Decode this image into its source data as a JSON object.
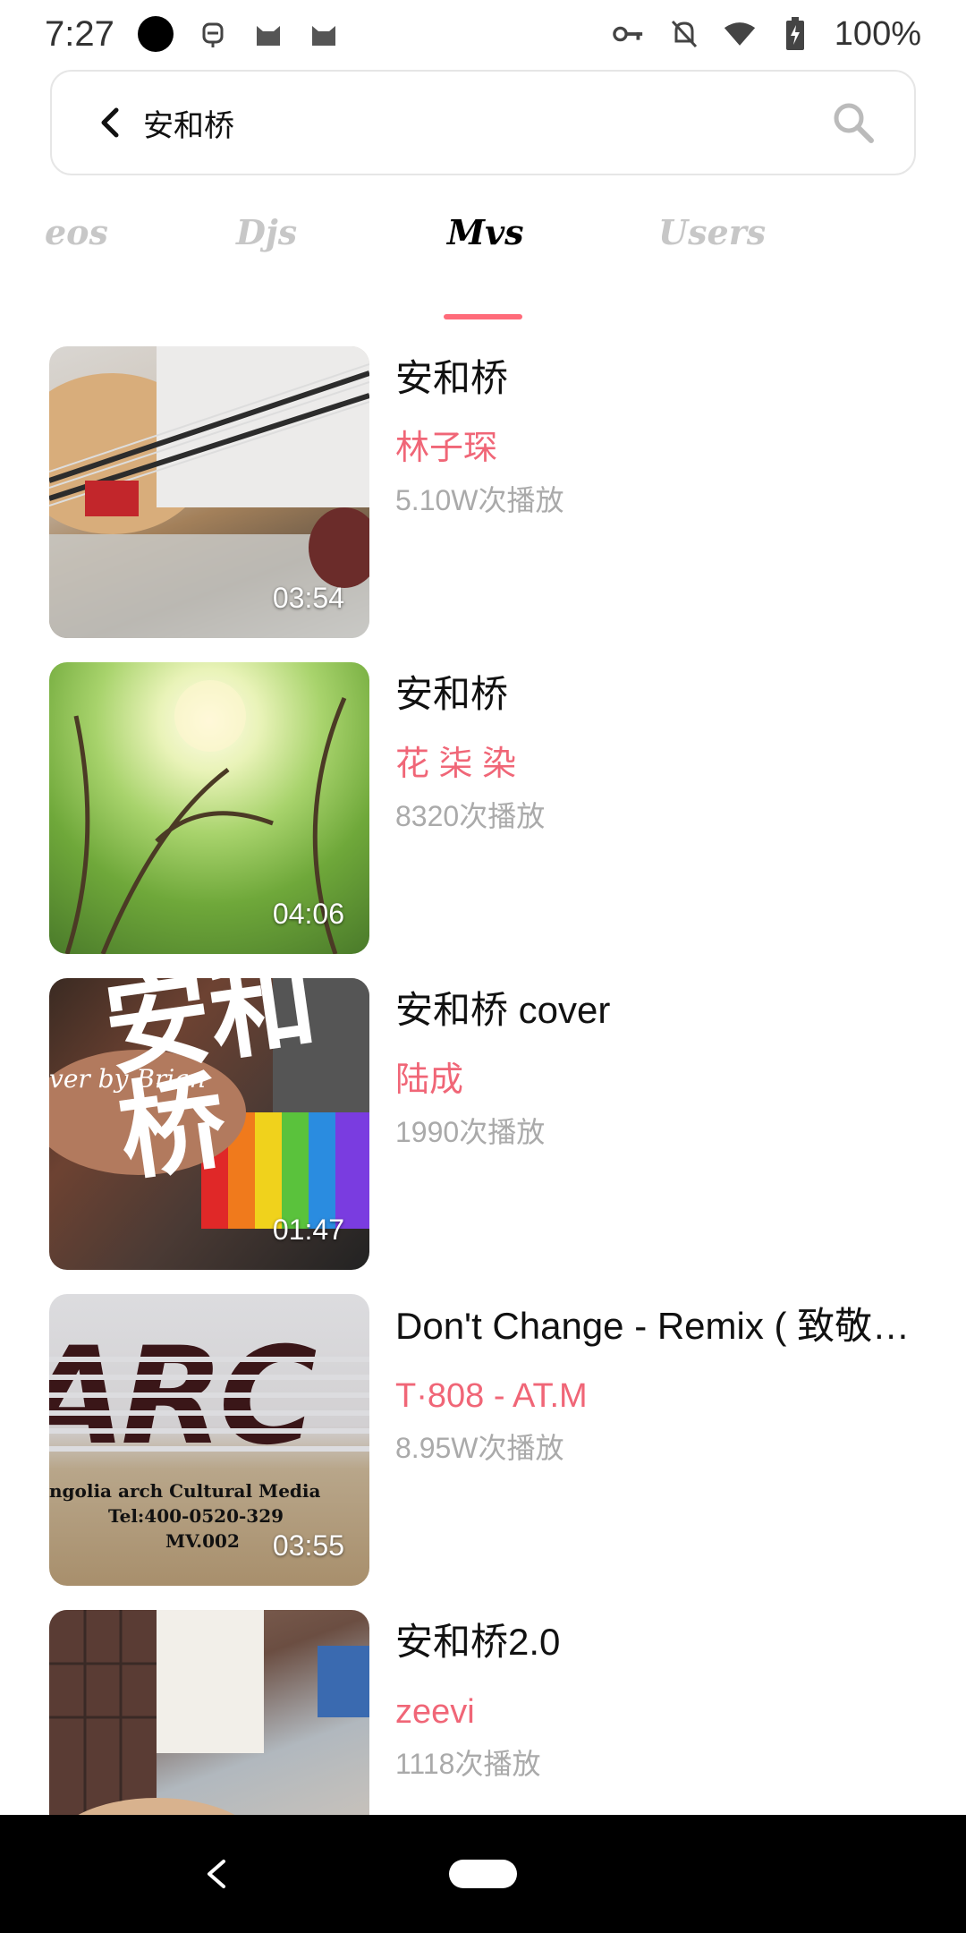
{
  "status_bar": {
    "time": "7:27",
    "battery": "100%",
    "icons": [
      "circle-icon",
      "cat-icon",
      "cat-icon",
      "cat-icon",
      "key-icon",
      "bell-off-icon",
      "wifi-icon",
      "battery-icon"
    ]
  },
  "search": {
    "query": "安和桥"
  },
  "tabs": [
    {
      "label": "Videos",
      "visible_label": "eos",
      "active": false
    },
    {
      "label": "Djs",
      "active": false
    },
    {
      "label": "Mvs",
      "active": true
    },
    {
      "label": "Users",
      "active": false
    }
  ],
  "mvs": [
    {
      "title": "安和桥",
      "artist": "林子琛",
      "plays": "5.10W次播放",
      "duration": "03:54"
    },
    {
      "title": "安和桥",
      "artist": "花 柒 染",
      "plays": "8320次播放",
      "duration": "04:06"
    },
    {
      "title": "安和桥 cover",
      "artist": "陆成",
      "plays": "1990次播放",
      "duration": "01:47"
    },
    {
      "title": "Don't Change - Remix ( 致敬…",
      "artist": "T·808 - AT.M",
      "plays": "8.95W次播放",
      "duration": "03:55"
    },
    {
      "title": "安和桥2.0",
      "artist": "zeevi",
      "plays": "1118次播放",
      "duration": ""
    }
  ],
  "thumb_texts": {
    "mv3_cover_text": "ver by Brian",
    "mv3_big_chars": "安和桥",
    "mv4_line1": "ngolia arch Cultural Media",
    "mv4_line2": "Tel:400-0520-329",
    "mv4_line3": "MV.002",
    "mv4_big": "ARC"
  },
  "colors": {
    "accent": "#ff6b7a",
    "artist": "#f06677",
    "muted": "#aaaaaa"
  }
}
